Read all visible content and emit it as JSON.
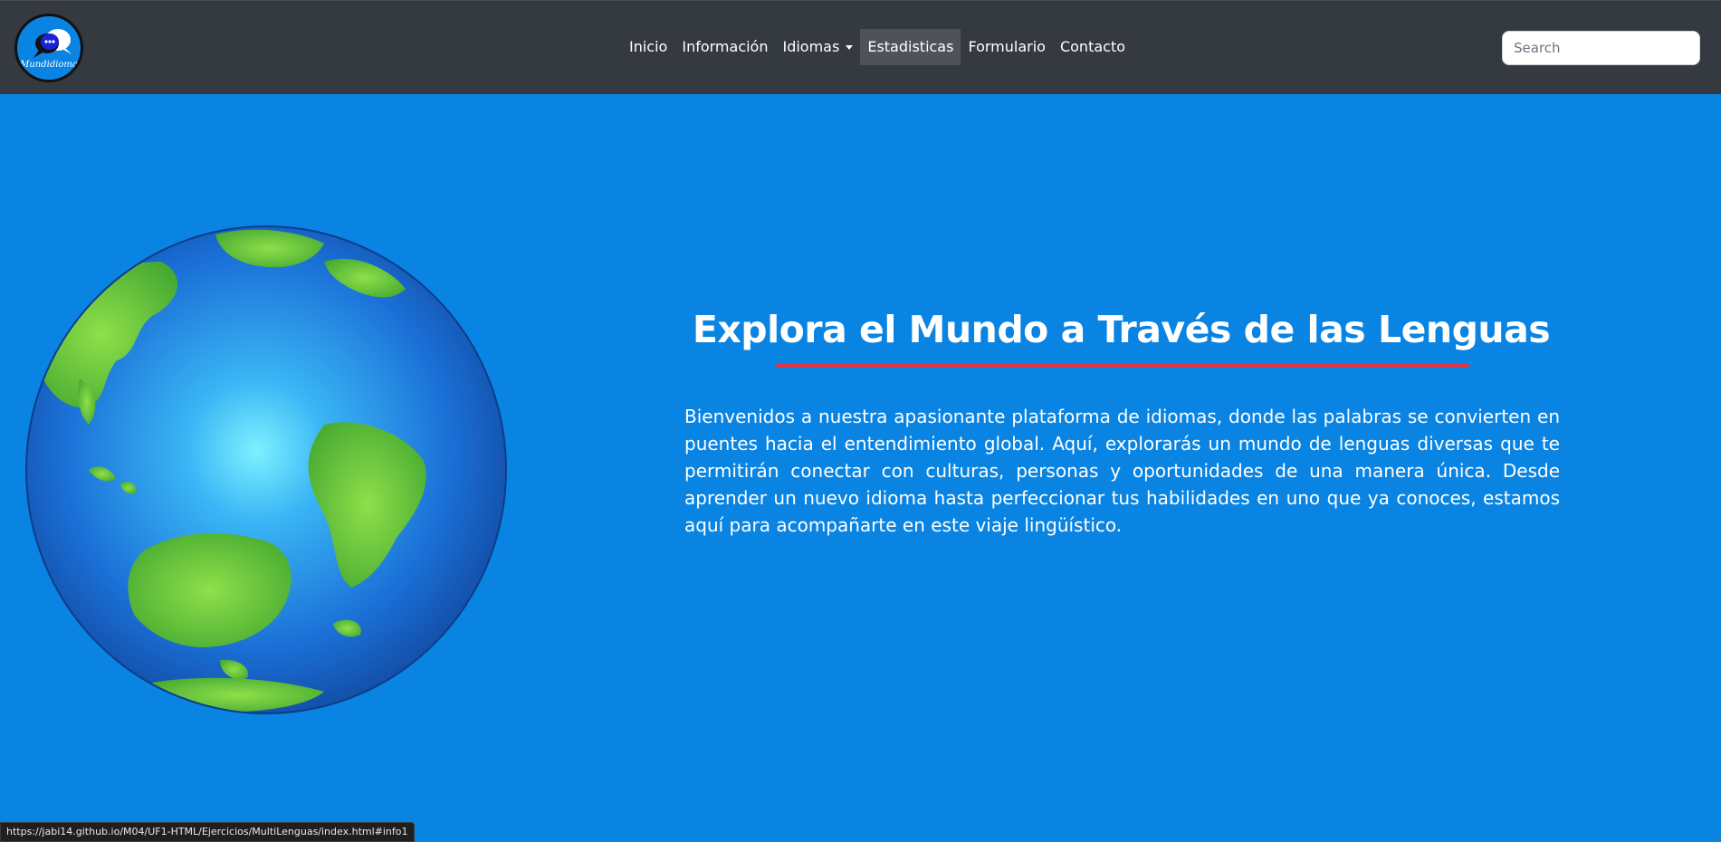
{
  "brand": {
    "logo_text": "Mundidioma"
  },
  "nav": {
    "items": [
      {
        "label": "Inicio"
      },
      {
        "label": "Información"
      },
      {
        "label": "Idiomas"
      },
      {
        "label": "Estadisticas"
      },
      {
        "label": "Formulario"
      },
      {
        "label": "Contacto"
      }
    ]
  },
  "search": {
    "placeholder": "Search"
  },
  "hero": {
    "title": "Explora el Mundo a Través de las Lenguas",
    "text": "Bienvenidos a nuestra apasionante plataforma de idiomas, donde las palabras se convierten en puentes hacia el entendimiento global. Aquí, explorarás un mundo de lenguas diversas que te permitirán conectar con culturas, personas y oportunidades de una manera única. Desde aprender un nuevo idioma hasta perfeccionar tus habilidades en uno que ya conoces, estamos aquí para acompañarte en este viaje lingüístico."
  },
  "status_bar": {
    "url": "https://jabi14.github.io/M04/UF1-HTML/Ejercicios/MultiLenguas/index.html#info1"
  },
  "colors": {
    "navbar_bg": "#343a40",
    "page_bg": "#0a84e3",
    "accent_underline": "#dc3545",
    "active_nav_bg": "#4d5358"
  }
}
